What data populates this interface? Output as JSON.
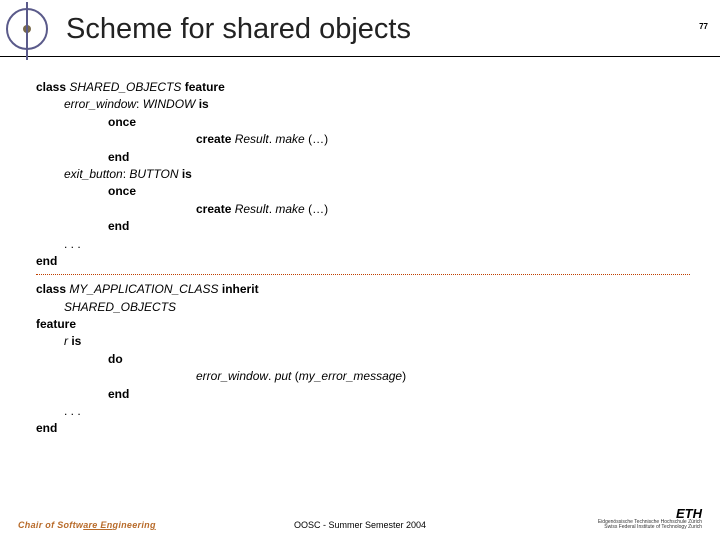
{
  "header": {
    "title": "Scheme for shared objects",
    "page_number": "77"
  },
  "code": {
    "l1a": "class",
    "l1b": "SHARED_OBJECTS",
    "l1c": "feature",
    "l2a": "error_window",
    "l2b": ": ",
    "l2c": "WINDOW ",
    "l2d": "is",
    "l3": "once",
    "l4a": "create ",
    "l4b": "Result",
    "l4c": ". ",
    "l4d": "make",
    "l4e": " (…)",
    "l5": "end",
    "l6a": "exit_button",
    "l6b": ": ",
    "l6c": "BUTTON ",
    "l6d": "is",
    "l7": "once",
    "l8a": "create ",
    "l8b": "Result",
    "l8c": ". ",
    "l8d": "make",
    "l8e": " (…)",
    "l9": "end",
    "l10": ". . .",
    "l11": "end",
    "l12a": "class",
    "l12b": "MY_APPLICATION_CLASS",
    "l12c": "inherit",
    "l13": "SHARED_OBJECTS",
    "l14": "feature",
    "l15a": "r ",
    "l15b": "is",
    "l16": "do",
    "l17a": "error_window",
    "l17b": ". ",
    "l17c": "put",
    "l17d": " (",
    "l17e": "my_error_message",
    "l17f": ")",
    "l18": "end",
    "l19": ". . .",
    "l20": "end"
  },
  "footer": {
    "left_a": "Chair of Softw",
    "left_b": "are En",
    "left_c": "gineerin",
    "left_d": "g",
    "center": "OOSC - Summer Semester 2004",
    "right_logo": "ETH",
    "right_sub1": "Eidgenössische Technische Hochschule Zürich",
    "right_sub2": "Swiss Federal Institute of Technology Zurich"
  }
}
